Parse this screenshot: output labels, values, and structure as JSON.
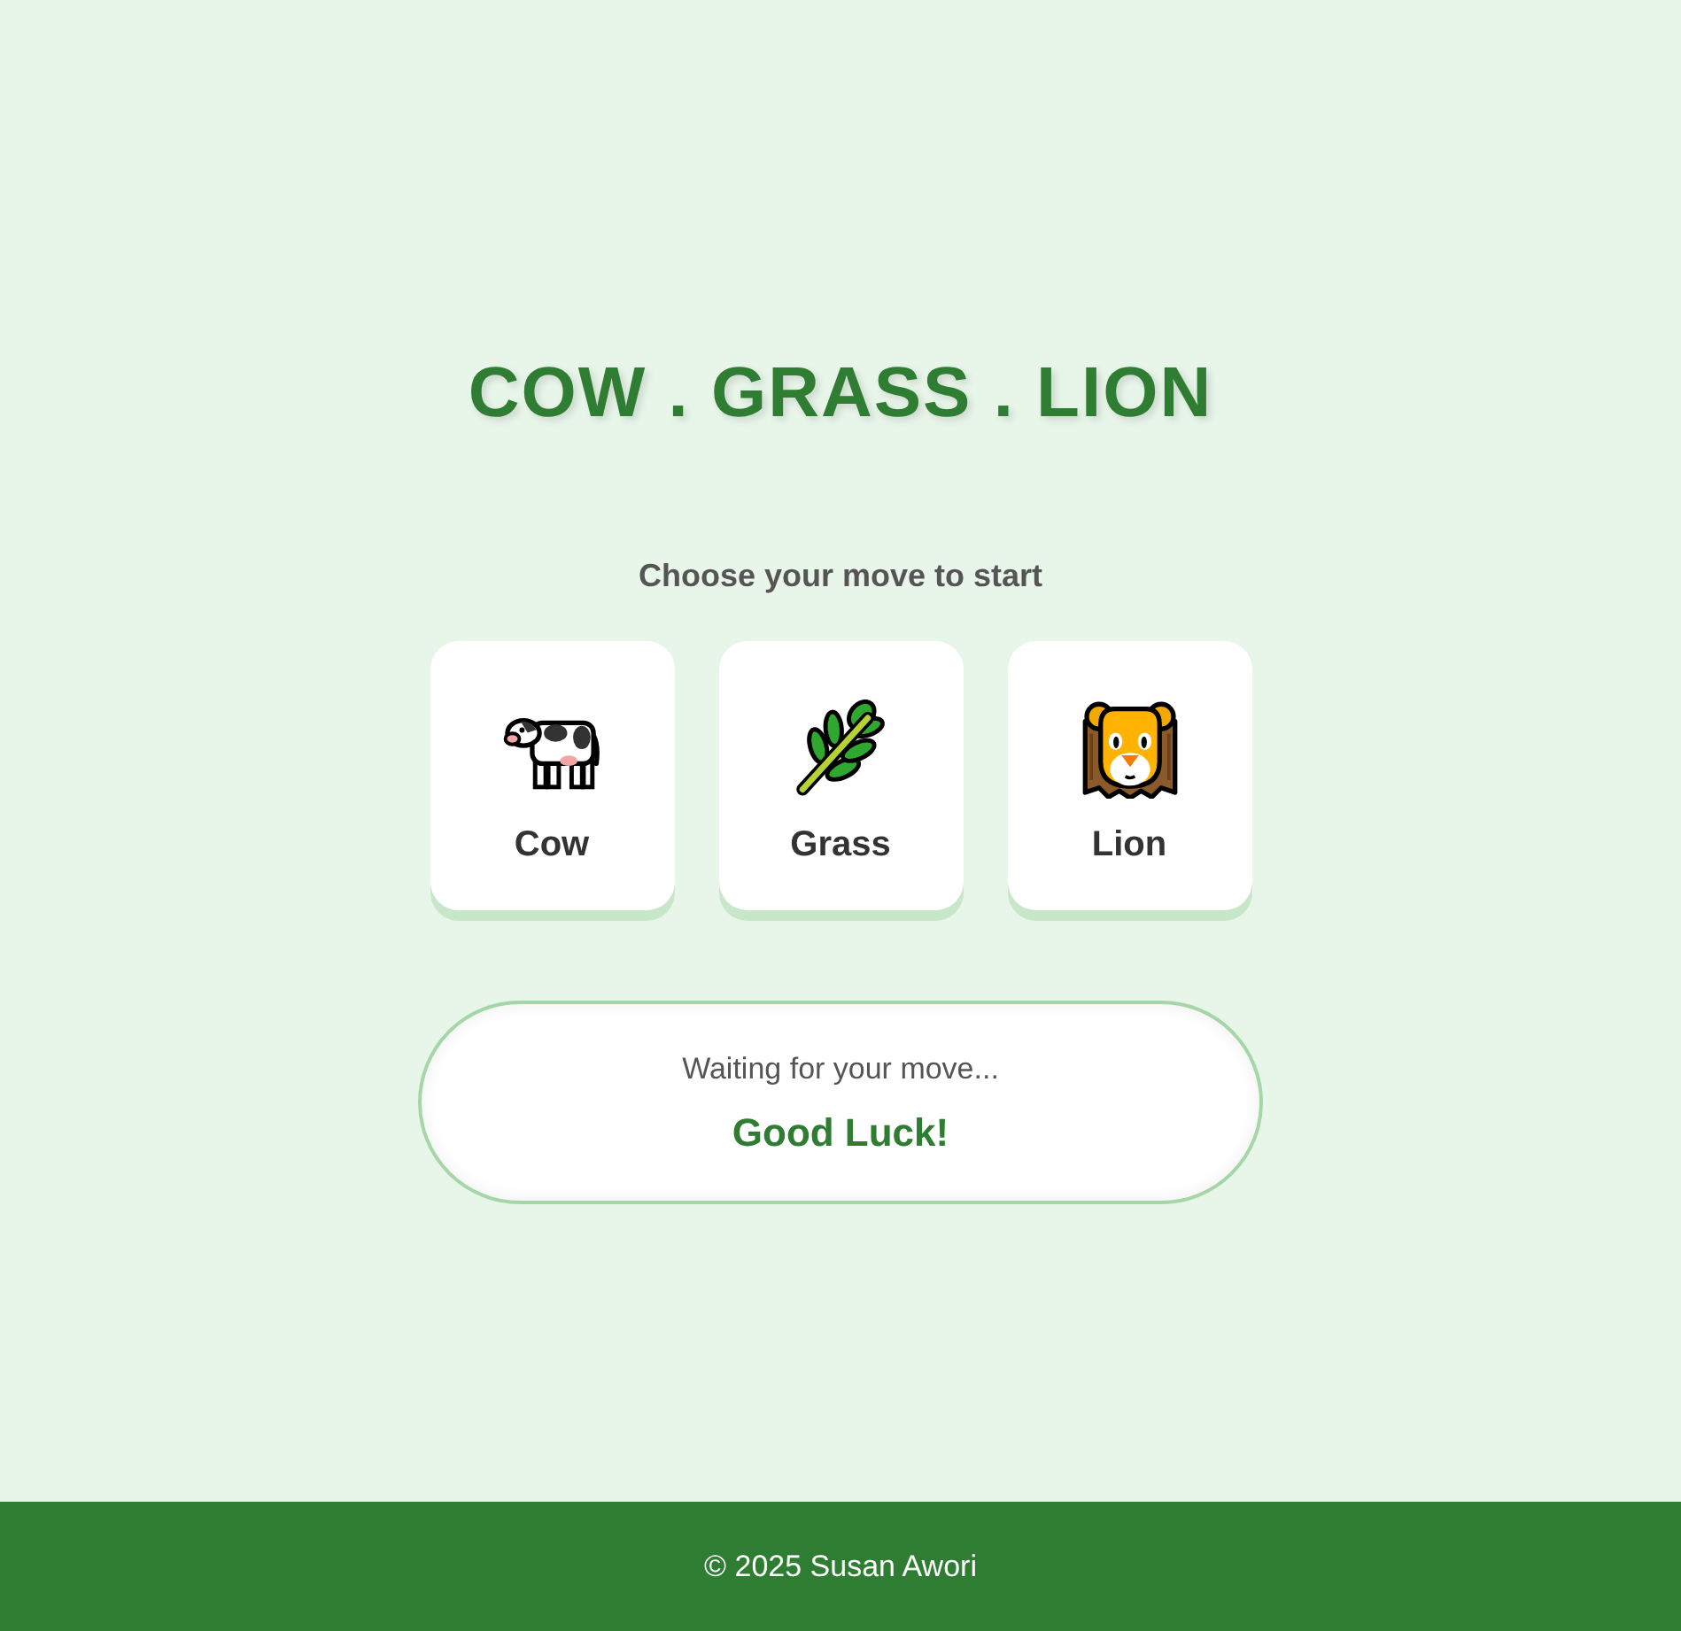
{
  "title": "COW . GRASS . LION",
  "prompt": "Choose your move to start",
  "choices": [
    {
      "label": "Cow",
      "kind": "cow"
    },
    {
      "label": "Grass",
      "kind": "grass"
    },
    {
      "label": "Lion",
      "kind": "lion"
    }
  ],
  "result": {
    "status": "Waiting for your move...",
    "message": "Good Luck!"
  },
  "footer": {
    "text": "© 2025 Susan Awori"
  }
}
